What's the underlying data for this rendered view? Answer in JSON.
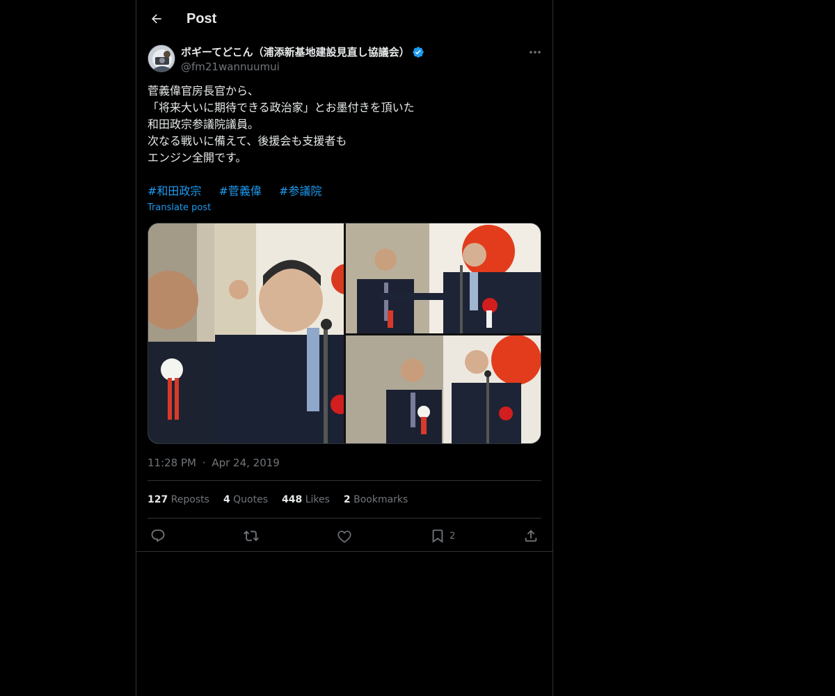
{
  "header": {
    "title": "Post",
    "back_icon": "arrow-left-icon"
  },
  "author": {
    "display_name": "ボギーてどこん（浦添新基地建設見直し協議会）",
    "handle": "@fm21wannuumui",
    "verified_icon": "verified-badge-icon"
  },
  "post": {
    "text_lines": [
      "菅義偉官房長官から、",
      "「将来大いに期待できる政治家」とお墨付きを頂いた",
      "和田政宗参議院議員。",
      "次なる戦いに備えて、後援会も支援者も",
      "エンジン全開です。"
    ],
    "hashtags": [
      "#和田政宗",
      "#菅義偉",
      "#参議院"
    ],
    "translate_label": "Translate post",
    "time": "11:28 PM",
    "separator": "·",
    "date": "Apr 24, 2019"
  },
  "stats": {
    "reposts": {
      "count": "127",
      "label": "Reposts"
    },
    "quotes": {
      "count": "4",
      "label": "Quotes"
    },
    "likes": {
      "count": "448",
      "label": "Likes"
    },
    "bookmarks": {
      "count": "2",
      "label": "Bookmarks"
    }
  },
  "actions": {
    "reply_icon": "reply-icon",
    "repost_icon": "repost-icon",
    "like_icon": "heart-icon",
    "bookmark_icon": "bookmark-icon",
    "bookmark_count": "2",
    "share_icon": "share-icon"
  },
  "colors": {
    "background": "#000000",
    "text": "#e7e9ea",
    "muted": "#71767b",
    "accent": "#1d9bf0",
    "border": "#2f3336"
  }
}
